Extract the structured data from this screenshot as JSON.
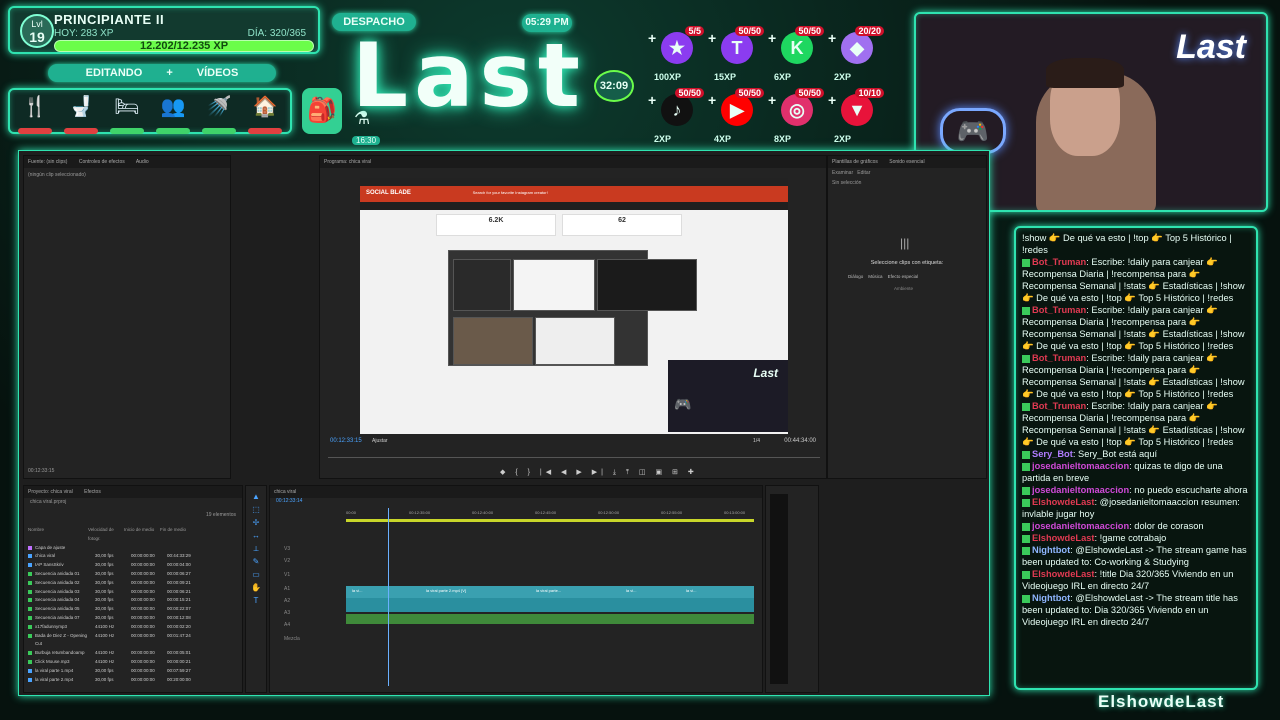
{
  "hud": {
    "level_label": "Lvl",
    "level": "19",
    "rank": "PRINCIPIANTE II",
    "today_xp": "HOY: 283 XP",
    "day": "DÍA: 320/365",
    "xp_progress": "12.202/12.235 XP",
    "mode": "EDITANDO",
    "mode_plus": "+",
    "mode2": "VÍDEOS",
    "despacho": "DESPACHO",
    "clock": "05:29 PM",
    "timer": "32:09",
    "potion_time": "16:30",
    "logo": "Last",
    "needs": [
      {
        "icon": "🍴",
        "bar": "red"
      },
      {
        "icon": "🚽",
        "bar": "red"
      },
      {
        "icon": "🛏",
        "bar": "green"
      },
      {
        "icon": "👥",
        "bar": "green"
      },
      {
        "icon": "🚿",
        "bar": "green"
      },
      {
        "icon": "🏠",
        "bar": "red"
      }
    ],
    "rewards": [
      {
        "count": "5/5",
        "xp": "100XP",
        "icon": "★",
        "color": "#8b3cf0"
      },
      {
        "count": "50/50",
        "xp": "15XP",
        "icon": "T",
        "color": "#8b3cf0"
      },
      {
        "count": "50/50",
        "xp": "6XP",
        "icon": "K",
        "color": "#1ed760"
      },
      {
        "count": "20/20",
        "xp": "2XP",
        "icon": "◆",
        "color": "#a070f0"
      },
      {
        "count": "50/50",
        "xp": "2XP",
        "icon": "♪",
        "color": "#111111"
      },
      {
        "count": "50/50",
        "xp": "4XP",
        "icon": "▶",
        "color": "#ff0000"
      },
      {
        "count": "50/50",
        "xp": "8XP",
        "icon": "◎",
        "color": "#e1306c"
      },
      {
        "count": "10/10",
        "xp": "2XP",
        "icon": "▼",
        "color": "#e8133a"
      }
    ]
  },
  "webcam": {
    "logo": "Last"
  },
  "chat": [
    {
      "user": "",
      "text": "!show 👉 De qué va esto | !top 👉 Top 5 Histórico | !redes"
    },
    {
      "user": "Bot_Truman",
      "cls": "u-red",
      "text": ": Escribe: !daily para canjear 👉 Recompensa Diaria | !recompensa para 👉 Recompensa Semanal | !stats 👉 Estadísticas | !show 👉 De qué va esto | !top 👉 Top 5 Histórico | !redes"
    },
    {
      "user": "Bot_Truman",
      "cls": "u-red",
      "text": ": Escribe: !daily para canjear 👉 Recompensa Diaria | !recompensa para 👉 Recompensa Semanal | !stats 👉 Estadísticas | !show 👉 De qué va esto | !top 👉 Top 5 Histórico | !redes"
    },
    {
      "user": "Bot_Truman",
      "cls": "u-red",
      "text": ": Escribe: !daily para canjear 👉 Recompensa Diaria | !recompensa para 👉 Recompensa Semanal | !stats 👉 Estadísticas | !show 👉 De qué va esto | !top 👉 Top 5 Histórico | !redes"
    },
    {
      "user": "Bot_Truman",
      "cls": "u-red",
      "text": ": Escribe: !daily para canjear 👉 Recompensa Diaria | !recompensa para 👉 Recompensa Semanal | !stats 👉 Estadísticas | !show 👉 De qué va esto | !top 👉 Top 5 Histórico | !redes"
    },
    {
      "user": "Sery_Bot",
      "cls": "u-purple",
      "text": ": Sery_Bot está aquí"
    },
    {
      "user": "josedanieltomaaccion",
      "cls": "u-pink",
      "text": ": quizas te digo de una partida en breve"
    },
    {
      "user": "josedanieltomaaccion",
      "cls": "u-pink",
      "text": ": no puedo escucharte ahora"
    },
    {
      "user": "ElshowdeLast",
      "cls": "u-red",
      "text": ": @josedanieltomaaccion resumen: invlable jugar hoy"
    },
    {
      "user": "josedanieltomaaccion",
      "cls": "u-pink",
      "text": ": dolor de corason"
    },
    {
      "user": "ElshowdeLast",
      "cls": "u-red",
      "text": ": !game cotrabajo"
    },
    {
      "user": "Nightbot",
      "cls": "u-nb",
      "text": ": @ElshowdeLast -> The stream game has been updated to: Co-working & Studying"
    },
    {
      "user": "ElshowdeLast",
      "cls": "u-red",
      "text": ": !title Dia 320/365 Viviendo en un Videojuego IRL en directo 24/7"
    },
    {
      "user": "Nightbot",
      "cls": "u-nb",
      "text": ": @ElshowdeLast -> The stream title has been updated to: Dia 320/365 Viviendo en un Videojuego IRL en directo 24/7"
    }
  ],
  "handle": "ElshowdeLast",
  "premiere": {
    "src_tabs": [
      "Fuente: (sin clips)",
      "Controles de efectos",
      "Audio"
    ],
    "src_empty": "(ningún clip seleccionado)",
    "src_tc": "00:12:33:15",
    "prog_title": "Programa: chica viral",
    "sb_title": "SOCIAL BLADE",
    "sb_search": "Search for your favorite Instagram creator!",
    "stat1": "6.2K",
    "stat2": "62",
    "prog_tc": "00:12:33:15",
    "prog_fit": "Ajustar",
    "prog_quality": "1/4",
    "prog_duration": "00:44:34:00",
    "ess_tabs": [
      "Plantillas de gráficos",
      "Sonido esencial"
    ],
    "ess_sub": [
      "Examinar",
      "Editar"
    ],
    "ess_sel": "Sin selección",
    "ess_label": "Seleccione clips con etiqueta:",
    "ess_btns": [
      "Diálogo",
      "Música",
      "Efecto especial"
    ],
    "ess_amb": "Ambiente",
    "proj_tabs": [
      "Proyecto: chica viral",
      "Efectos"
    ],
    "proj_file": "chica viral.prproj",
    "proj_count": "19 elementos",
    "proj_cols": [
      "Nombre",
      "Velocidad de fotogr.",
      "Inicio de medio",
      "Fin de medio"
    ],
    "proj_rows": [
      [
        "Capa de ajuste",
        "",
        "",
        ""
      ],
      [
        "chica viral",
        "30,00 fps",
        "00:00:00:00",
        "00:44:33:29"
      ],
      [
        "IAP SansSkriv",
        "30,00 fps",
        "00:00:00:00",
        "00:00:04:00"
      ],
      [
        "Secuencia anidada 01",
        "30,00 fps",
        "00:00:00:00",
        "00:00:06:27"
      ],
      [
        "Secuencia anidada 02",
        "30,00 fps",
        "00:00:00:00",
        "00:00:09:21"
      ],
      [
        "Secuencia anidada 03",
        "30,00 fps",
        "00:00:00:00",
        "00:00:06:21"
      ],
      [
        "Secuencia anidada 04",
        "30,00 fps",
        "00:00:00:00",
        "00:00:15:21"
      ],
      [
        "Secuencia anidada 05",
        "30,00 fps",
        "00:00:00:00",
        "00:00:22:07"
      ],
      [
        "Secuencia anidada 07",
        "30,00 fps",
        "00:00:00:00",
        "00:00:12:08"
      ],
      [
        "x17fadunnymp3",
        "44100 Hz",
        "00:00:00:00",
        "00:00:02:20"
      ],
      [
        "Bada de Diez Z - Opening Cut",
        "44100 Hz",
        "00:00:00:00",
        "00:01:47:24"
      ],
      [
        "Burbuja retumbandoamp",
        "44100 Hz",
        "00:00:00:00",
        "00:00:05:01"
      ],
      [
        "Click Mouse.mp3",
        "44100 Hz",
        "00:00:00:00",
        "00:00:00:21"
      ],
      [
        "la viral parte 1.mp4",
        "30,00 fps",
        "00:00:00:00",
        "00:07:59:27"
      ],
      [
        "la viral parte 2.mp4",
        "30,00 fps",
        "00:00:00:00",
        "00:20:00:00"
      ]
    ],
    "tl_tab": "chica viral",
    "tl_tc": "00:12:33:14",
    "tl_ticks": [
      "00:00",
      "00:12:35:00",
      "00:12:40:00",
      "00:12:45:00",
      "00:12:50:00",
      "00:12:55:00",
      "00:13:00:00"
    ],
    "tracks": [
      "V3",
      "V2",
      "V1",
      "A1",
      "A2",
      "A3",
      "A4",
      "Mezcla"
    ],
    "clip_labels": [
      "la vi...",
      "la viral parte 2.mp4 [V]",
      "la viral parte...",
      "la vi...",
      "la vi..."
    ]
  }
}
